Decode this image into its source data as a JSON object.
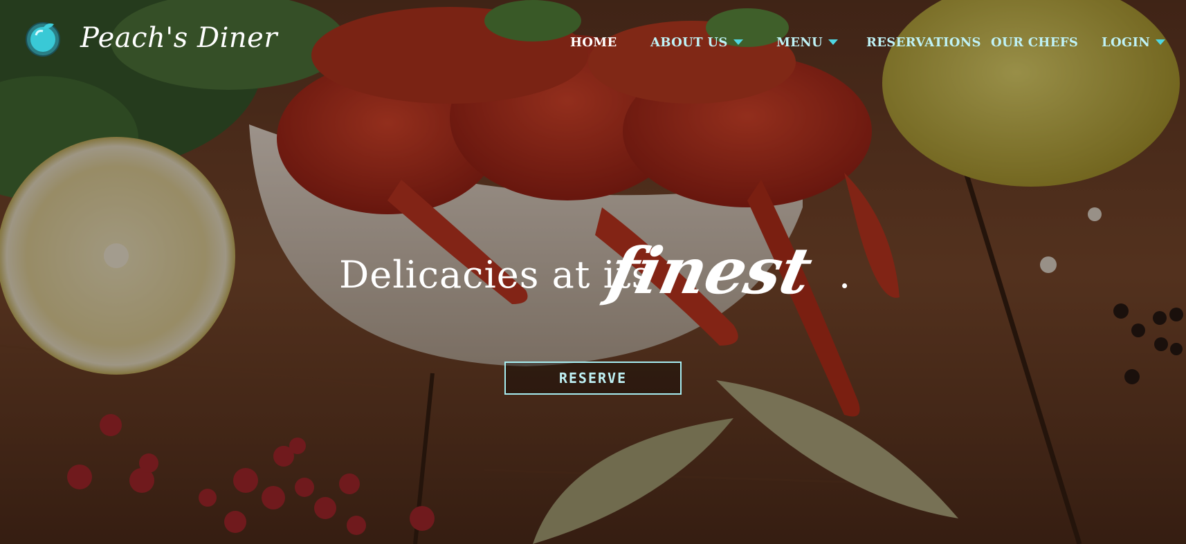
{
  "brand": {
    "name": "Peach's Diner",
    "logo_icon": "peach-icon",
    "accent_color": "#4fd6e2",
    "nav_text_color": "#bff2f6"
  },
  "nav": {
    "home": "HOME",
    "about": "ABOUT US",
    "menu": "MENU",
    "reservations": "RESERVATIONS",
    "chefs": "OUR CHEFS",
    "login": "LOGIN"
  },
  "hero": {
    "headline_main": "Delicacies at its",
    "headline_script": "finest",
    "headline_end": ".",
    "cta_label": "RESERVE",
    "background_icon": "crayfish-bowl-photo"
  }
}
